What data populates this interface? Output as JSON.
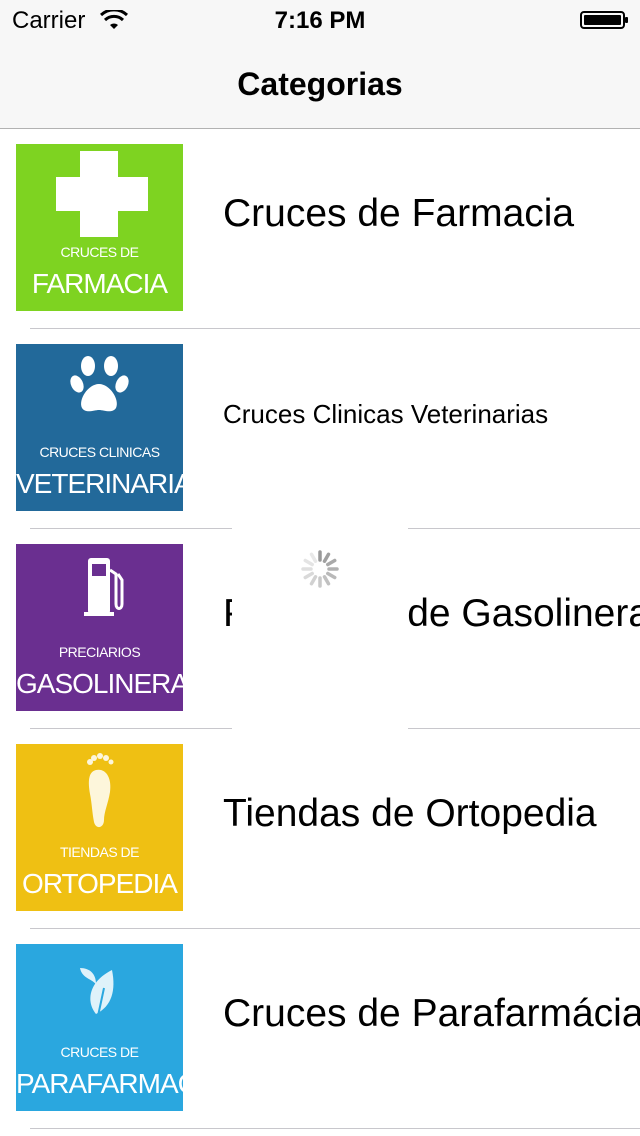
{
  "status_bar": {
    "carrier": "Carrier",
    "time": "7:16 PM"
  },
  "nav": {
    "title": "Categorias"
  },
  "colors": {
    "farmacia": "#7ed321",
    "veterinarias": "#22699a",
    "gasolineras": "#6a2f90",
    "ortopedia": "#efc013",
    "parafarmacia": "#2aa7df"
  },
  "categories": [
    {
      "label": "Cruces de Farmacia",
      "thumb_small": "CRUCES DE",
      "thumb_big": "FARMACIA",
      "icon": "cross-icon"
    },
    {
      "label": "Cruces Clinicas Veterinarias",
      "thumb_small": "CRUCES CLINICAS",
      "thumb_big": "VETERINARIAS",
      "icon": "paw-icon"
    },
    {
      "label": "Preciarios de Gasolineras",
      "thumb_small": "PRECIARIOS",
      "thumb_big": "GASOLINERAS",
      "icon": "fuel-pump-icon"
    },
    {
      "label": "Tiendas de Ortopedia",
      "thumb_small": "TIENDAS DE",
      "thumb_big": "ORTOPEDIA",
      "icon": "foot-icon"
    },
    {
      "label": "Cruces de Parafarmácia",
      "thumb_small": "CRUCES DE",
      "thumb_big": "PARAFARMACIA",
      "icon": "leaf-icon"
    }
  ]
}
